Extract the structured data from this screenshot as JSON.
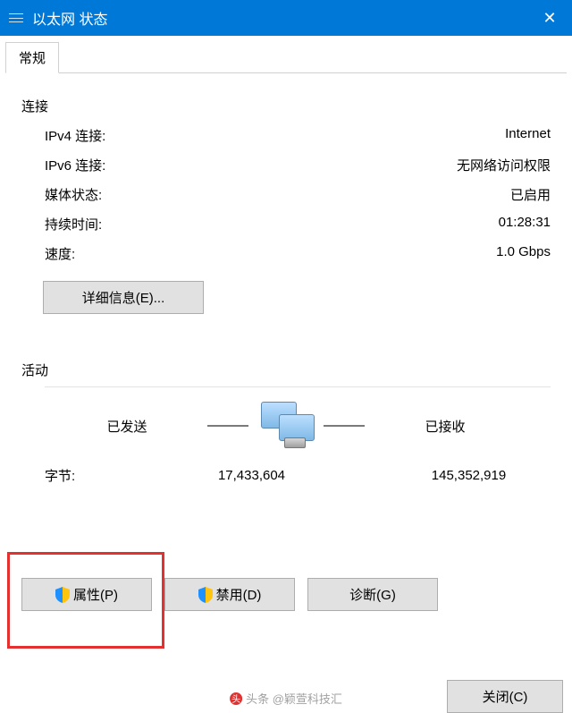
{
  "window": {
    "title": "以太网 状态"
  },
  "tabs": {
    "general": "常规"
  },
  "connection": {
    "section": "连接",
    "ipv4_label": "IPv4 连接:",
    "ipv4_value": "Internet",
    "ipv6_label": "IPv6 连接:",
    "ipv6_value": "无网络访问权限",
    "media_label": "媒体状态:",
    "media_value": "已启用",
    "duration_label": "持续时间:",
    "duration_value": "01:28:31",
    "speed_label": "速度:",
    "speed_value": "1.0 Gbps",
    "details_button": "详细信息(E)..."
  },
  "activity": {
    "section": "活动",
    "sent_label": "已发送",
    "received_label": "已接收",
    "bytes_label": "字节:",
    "bytes_sent": "17,433,604",
    "bytes_received": "145,352,919"
  },
  "buttons": {
    "properties": "属性(P)",
    "disable": "禁用(D)",
    "diagnose": "诊断(G)",
    "close": "关闭(C)"
  },
  "watermark": "头条 @颖萱科技汇"
}
